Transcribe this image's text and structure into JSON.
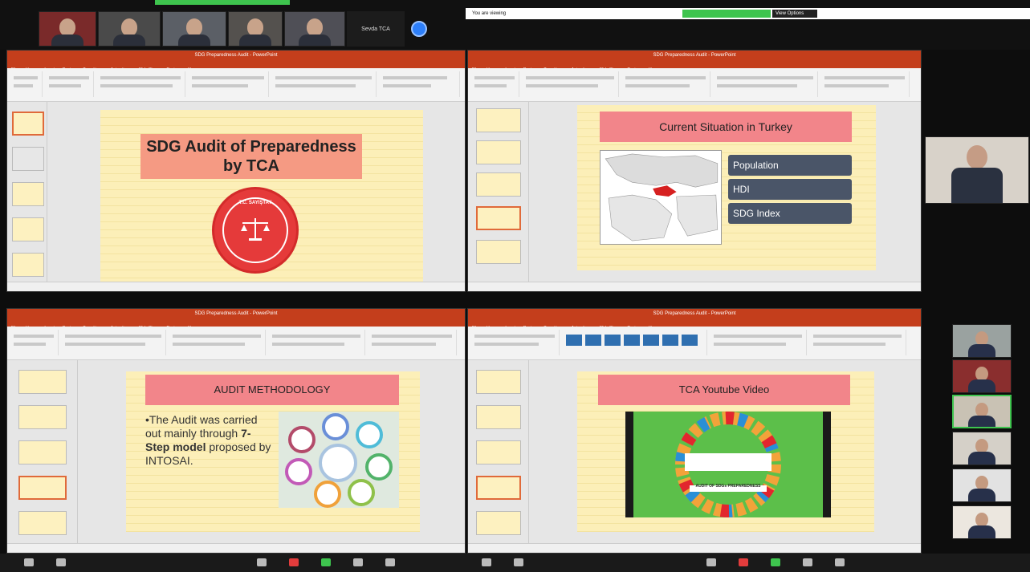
{
  "zoom": {
    "speaker_tile": "Sevda TCA",
    "top_banner": "You are viewing",
    "view_options": "View Options"
  },
  "windows": {
    "top_left": {
      "window_title": "SDG Preparedness Audit - PowerPoint",
      "slide": {
        "title_line1": "SDG Audit of Preparedness",
        "title_line2": "by TCA",
        "seal_text": "T.C. SAYIŞTAY"
      }
    },
    "top_right": {
      "window_title": "SDG Preparedness Audit - PowerPoint",
      "slide": {
        "title": "Current Situation in Turkey",
        "items": [
          "Population",
          "HDI",
          "SDG Index"
        ]
      }
    },
    "bottom_left": {
      "window_title": "SDG Preparedness Audit - PowerPoint",
      "slide": {
        "title": "AUDIT METHODOLOGY",
        "bullet_prefix": "•The Audit was carried out mainly through ",
        "bullet_bold1": "7-Step model",
        "bullet_suffix": " proposed by INTOSAI."
      }
    },
    "bottom_right": {
      "window_title": "SDG Preparedness Audit - PowerPoint",
      "slide": {
        "title": "TCA Youtube Video",
        "video_caption": "AUDIT OF SDGs PREPAREDNESS"
      }
    }
  },
  "colors": {
    "ppt_red": "#c43e1c",
    "slide_bg": "#fcefb8",
    "title_pink": "#f2858a",
    "info_box": "#4a5568",
    "seal_red": "#e53a3a",
    "zoom_blue": "#2d7ff9"
  }
}
